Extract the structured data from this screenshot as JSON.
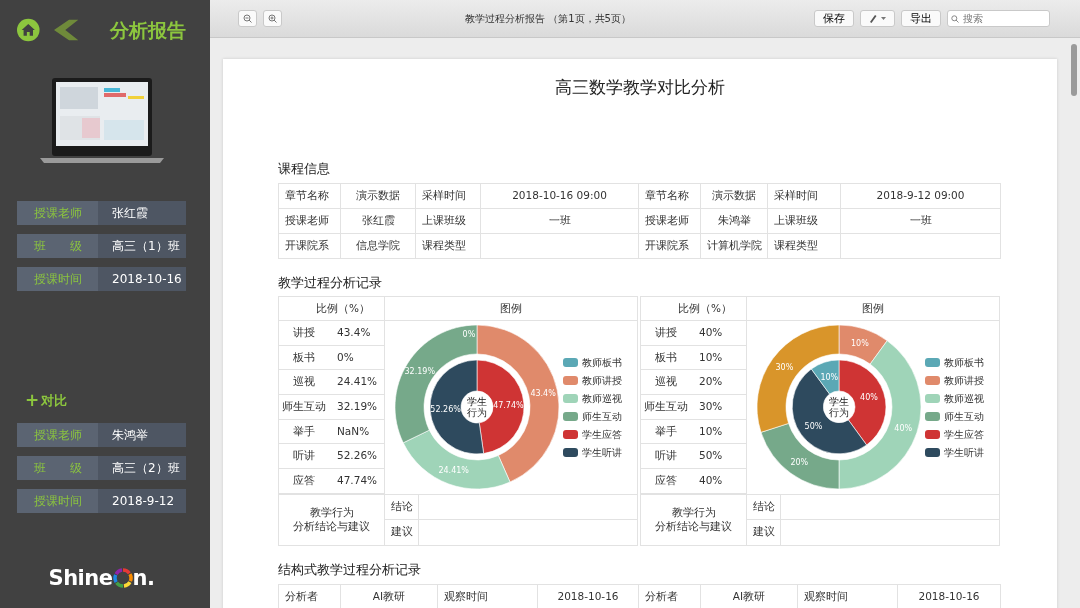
{
  "sidebar": {
    "title": "分析报告",
    "info_rows": [
      {
        "label": "授课老师",
        "value": "张红霞"
      },
      {
        "label": "班　　级",
        "value": "高三（1）班"
      },
      {
        "label": "授课时间",
        "value": "2018-10-16"
      }
    ],
    "compare_icon": "+",
    "compare_label": "对比",
    "compare_rows": [
      {
        "label": "授课老师",
        "value": "朱鸿举"
      },
      {
        "label": "班　　级",
        "value": "高三（2）班"
      },
      {
        "label": "授课时间",
        "value": "2018-9-12"
      }
    ],
    "logo": {
      "prefix": "Shine",
      "suffix": "n."
    }
  },
  "toolbar": {
    "title": "教学过程分析报告 （第1页，共5页）",
    "buttons": [
      "保存",
      "导出"
    ],
    "search": {
      "placeholder": "搜索"
    }
  },
  "report": {
    "title": "高三数学教学对比分析",
    "course_info": {
      "heading": "课程信息",
      "rows": [
        [
          "章节名称",
          "演示数据",
          "采样时间",
          "2018-10-16 09:00",
          "章节名称",
          "演示数据",
          "采样时间",
          "2018-9-12  09:00"
        ],
        [
          "授课老师",
          "张红霞",
          "上课班级",
          "一班",
          "授课老师",
          "朱鸿举",
          "上课班级",
          "一班"
        ],
        [
          "开课院系",
          "信息学院",
          "课程类型",
          "",
          "开课院系",
          "计算机学院",
          "课程类型",
          ""
        ]
      ]
    },
    "process": {
      "heading": "教学过程分析记录",
      "blocks": [
        {
          "ratio_header": "比例（%）",
          "legend_header": "图例",
          "rows": [
            {
              "label": "讲授",
              "value": "43.4%"
            },
            {
              "label": "板书",
              "value": "0%"
            },
            {
              "label": "巡视",
              "value": "24.41%"
            },
            {
              "label": "师生互动",
              "value": "32.19%"
            },
            {
              "label": "举手",
              "value": "NaN%"
            },
            {
              "label": "听讲",
              "value": "52.26%"
            },
            {
              "label": "应答",
              "value": "47.74%"
            }
          ],
          "center_label": [
            "学生",
            "行为"
          ],
          "chart_data": {
            "type": "donut",
            "series": [
              {
                "values": [
                  0,
                  43.4,
                  24.41,
                  32.19
                ],
                "colors": [
                  "#5ba8b5",
                  "#e08a6b",
                  "#9fd4b8",
                  "#76a98a"
                ],
                "value_labels": [
                  "0%",
                  "43.4%",
                  "24.41%",
                  "32.19%"
                ]
              },
              {
                "values": [
                  47.74,
                  52.26
                ],
                "colors": [
                  "#cf3434",
                  "#2e4a5e"
                ],
                "value_labels": [
                  "47.74%",
                  "52.26%"
                ]
              }
            ],
            "data_labels": "value_labels"
          },
          "legend": [
            {
              "label": "教师板书",
              "color": "#5ba8b5"
            },
            {
              "label": "教师讲授",
              "color": "#e08a6b"
            },
            {
              "label": "教师巡视",
              "color": "#9fd4b8"
            },
            {
              "label": "师生互动",
              "color": "#76a98a"
            },
            {
              "label": "学生应答",
              "color": "#cf3434"
            },
            {
              "label": "学生听讲",
              "color": "#2e4a5e"
            }
          ],
          "conclusion_title": [
            "教学行为",
            "分析结论与建议"
          ],
          "conclusion_rows": [
            "结论",
            "建议"
          ]
        },
        {
          "ratio_header": "比例（%）",
          "legend_header": "图例",
          "rows": [
            {
              "label": "讲授",
              "value": "40%"
            },
            {
              "label": "板书",
              "value": "10%"
            },
            {
              "label": "巡视",
              "value": "20%"
            },
            {
              "label": "师生互动",
              "value": "30%"
            },
            {
              "label": "举手",
              "value": "10%"
            },
            {
              "label": "听讲",
              "value": "50%"
            },
            {
              "label": "应答",
              "value": "40%"
            }
          ],
          "center_label": [
            "学生",
            "行为"
          ],
          "chart_data": {
            "type": "donut",
            "series": [
              {
                "values": [
                  10,
                  40,
                  20,
                  30
                ],
                "colors": [
                  "#e08a6b",
                  "#9fd4b8",
                  "#76a98a",
                  "#d9952a"
                ],
                "value_labels": [
                  "10%",
                  "40%",
                  "20%",
                  "30%"
                ]
              },
              {
                "values": [
                  40,
                  50,
                  10
                ],
                "colors": [
                  "#cf3434",
                  "#2e4a5e",
                  "#5ba8b5"
                ],
                "value_labels": [
                  "40%",
                  "50%",
                  "10%"
                ]
              }
            ],
            "data_labels": "value_labels"
          },
          "legend": [
            {
              "label": "教师板书",
              "color": "#5ba8b5"
            },
            {
              "label": "教师讲授",
              "color": "#e08a6b"
            },
            {
              "label": "教师巡视",
              "color": "#9fd4b8"
            },
            {
              "label": "师生互动",
              "color": "#76a98a"
            },
            {
              "label": "学生应答",
              "color": "#cf3434"
            },
            {
              "label": "学生听讲",
              "color": "#2e4a5e"
            }
          ],
          "conclusion_title": [
            "教学行为",
            "分析结论与建议"
          ],
          "conclusion_rows": [
            "结论",
            "建议"
          ]
        }
      ]
    },
    "structured": {
      "heading": "结构式教学过程分析记录",
      "rows": [
        [
          "分析者",
          "AI教研",
          "观察时间",
          "2018-10-16",
          "分析者",
          "AI教研",
          "观察时间",
          "2018-10-16"
        ]
      ]
    }
  }
}
